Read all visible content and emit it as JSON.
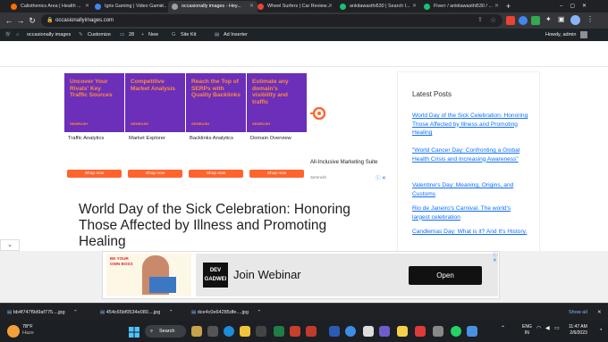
{
  "browser": {
    "tabs": [
      {
        "title": "Calisthenics Area | Health ...",
        "color": "#ff6d00"
      },
      {
        "title": "Igris Gaming | Video Game...",
        "color": "#4285f4"
      },
      {
        "title": "occasionally images - Hey...",
        "color": "#9aa0a6"
      },
      {
        "title": "Wheel Surfers | Car Review...",
        "color": "#ea4335"
      },
      {
        "title": "ankitawasthi530 | Search I...",
        "color": "#1dbf73"
      },
      {
        "title": "Fiverr / ankitawasthi530 / ...",
        "color": "#1dbf73"
      }
    ],
    "new_tab": "+",
    "url": "occasionallyimages.com"
  },
  "adminbar": {
    "site": "occasionally images",
    "customize": "Customize",
    "comments": "28",
    "new": "New",
    "sitekit": "Site Kit",
    "adinserter": "Ad Inserter",
    "howdy": "Howdy, admin"
  },
  "ads": [
    {
      "text": "Uncover Your Rivals' Key Traffic Sources",
      "label": "Traffic Analytics",
      "btn": "Shop now"
    },
    {
      "text": "Competitive Market Analysis",
      "label": "Market Explorer",
      "btn": "Shop now"
    },
    {
      "text": "Reach the Top of SERPs with Quality Backlinks",
      "label": "Backlinks Analytics",
      "btn": "Shop now"
    },
    {
      "text": "Estimate any domain's visibility and traffic",
      "label": "Domain Overview",
      "btn": "Shop now"
    }
  ],
  "ad_brand": "SEMRUSH",
  "ad_extra": {
    "title": "All-Inclusive Marketing Suite",
    "source": "Semrush",
    "adchoices": "ⓘ ✕"
  },
  "article": {
    "title": "World Day of the Sick Celebration: Honoring Those Affected by Illness and Promoting Healing"
  },
  "sidebar": {
    "heading": "Latest Posts",
    "posts": [
      "World Day of the Sick Celebration: Honoring Those Affected by Illness and Promoting Healing",
      "\"World Cancer Day: Confronting a Global Health Crisis and Increasing Awareness\"",
      "Valentine's Day: Meaning, Origins, and Customs",
      "Rio de Janeiro's Carnival. The world's largest celebration",
      "Candlemas Day: What is it? And It's History."
    ]
  },
  "bottom_ad": {
    "left_text": "BE YOUR OWN BOSS",
    "logo": "DEV GADWEI",
    "headline": "Join Webinar",
    "button": "Open"
  },
  "downloads": {
    "files": [
      "bb4f747f9d9af775....jpg",
      "454c65bf0534e080....jpg",
      "dce4c0e64285dfe....jpg"
    ],
    "show_all": "Show all"
  },
  "taskbar": {
    "temp": "78°F",
    "weather": "Haze",
    "search": "Search",
    "lang": "ENG",
    "region": "IN",
    "time": "11:47 AM",
    "date": "2/6/2023"
  },
  "colors": {
    "semrush_purple": "#6b2fba",
    "semrush_orange": "#ff642d",
    "link_blue": "#0d6efd"
  }
}
